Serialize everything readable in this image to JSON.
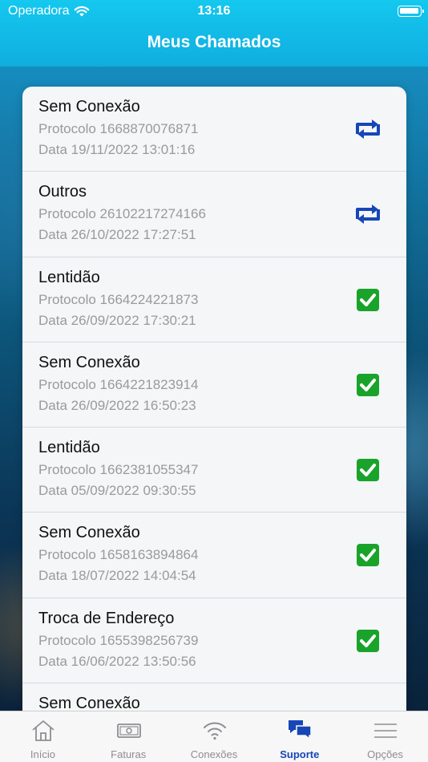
{
  "status_bar": {
    "carrier": "Operadora",
    "time": "13:16"
  },
  "header": {
    "title": "Meus Chamados"
  },
  "tickets": [
    {
      "title": "Sem Conexão",
      "protocol": "Protocolo 1668870076871",
      "date": "Data 19/11/2022 13:01:16",
      "status_icon": "refresh-icon"
    },
    {
      "title": "Outros",
      "protocol": "Protocolo 26102217274166",
      "date": "Data 26/10/2022 17:27:51",
      "status_icon": "refresh-icon"
    },
    {
      "title": "Lentidão",
      "protocol": "Protocolo 1664224221873",
      "date": "Data 26/09/2022 17:30:21",
      "status_icon": "check-icon"
    },
    {
      "title": "Sem Conexão",
      "protocol": "Protocolo 1664221823914",
      "date": "Data 26/09/2022 16:50:23",
      "status_icon": "check-icon"
    },
    {
      "title": "Lentidão",
      "protocol": "Protocolo 1662381055347",
      "date": "Data 05/09/2022 09:30:55",
      "status_icon": "check-icon"
    },
    {
      "title": "Sem Conexão",
      "protocol": "Protocolo 1658163894864",
      "date": "Data 18/07/2022 14:04:54",
      "status_icon": "check-icon"
    },
    {
      "title": "Troca de Endereço",
      "protocol": "Protocolo 1655398256739",
      "date": "Data 16/06/2022 13:50:56",
      "status_icon": "check-icon"
    },
    {
      "title": "Sem Conexão"
    }
  ],
  "tabbar": {
    "tabs": [
      {
        "label": "Início",
        "icon": "home-icon"
      },
      {
        "label": "Faturas",
        "icon": "banknote-icon"
      },
      {
        "label": "Conexões",
        "icon": "wifi-icon"
      },
      {
        "label": "Suporte",
        "icon": "chat-bubbles-icon",
        "active": true
      },
      {
        "label": "Opções",
        "icon": "menu-icon"
      }
    ]
  },
  "colors": {
    "header": "#14c8ee",
    "refresh_icon": "#1646b8",
    "check_icon": "#1aa32a",
    "active_tab": "#1646b8",
    "inactive_tab": "#8e8e93"
  }
}
